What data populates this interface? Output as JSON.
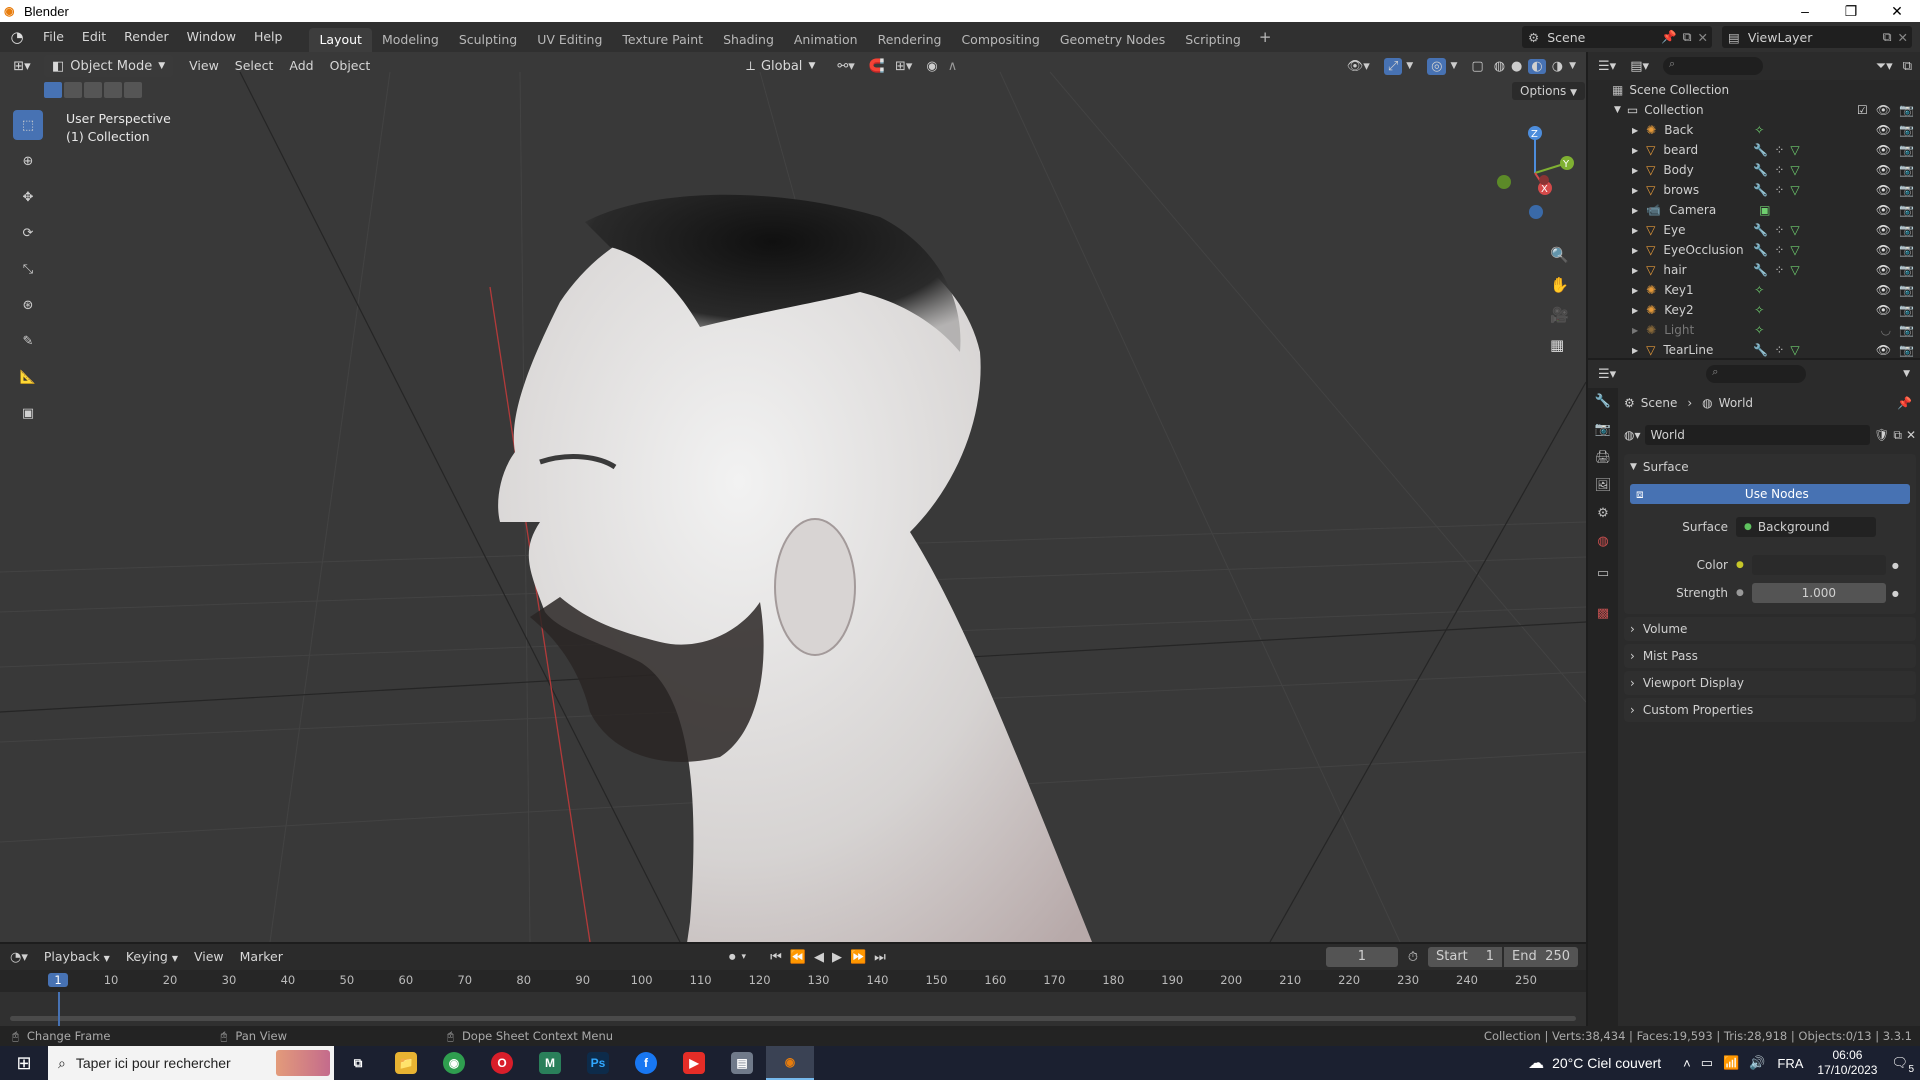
{
  "window": {
    "title": "Blender",
    "min": "–",
    "max": "❐",
    "close": "✕"
  },
  "menu": [
    "File",
    "Edit",
    "Render",
    "Window",
    "Help"
  ],
  "workspaces": [
    "Layout",
    "Modeling",
    "Sculpting",
    "UV Editing",
    "Texture Paint",
    "Shading",
    "Animation",
    "Rendering",
    "Compositing",
    "Geometry Nodes",
    "Scripting"
  ],
  "workspace_add": "+",
  "scene": {
    "label": "Scene",
    "view_layer": "ViewLayer"
  },
  "viewport": {
    "mode": "Object Mode",
    "menus": [
      "View",
      "Select",
      "Add",
      "Object"
    ],
    "orientation": "Global",
    "options": "Options",
    "overlay_title": "User Perspective",
    "overlay_sub": "(1) Collection",
    "gizmo": {
      "z": "Z",
      "y": "Y",
      "x": "X"
    }
  },
  "outliner": {
    "scene_collection": "Scene Collection",
    "collection": "Collection",
    "items": [
      {
        "name": "Back",
        "type": "light",
        "dim": false
      },
      {
        "name": "beard",
        "type": "mesh",
        "dim": false
      },
      {
        "name": "Body",
        "type": "mesh",
        "dim": false
      },
      {
        "name": "brows",
        "type": "mesh",
        "dim": false
      },
      {
        "name": "Camera",
        "type": "camera",
        "dim": false
      },
      {
        "name": "Eye",
        "type": "mesh",
        "dim": false
      },
      {
        "name": "EyeOcclusion",
        "type": "mesh",
        "dim": false
      },
      {
        "name": "hair",
        "type": "mesh",
        "dim": false
      },
      {
        "name": "Key1",
        "type": "light",
        "dim": false
      },
      {
        "name": "Key2",
        "type": "light",
        "dim": false
      },
      {
        "name": "Light",
        "type": "light",
        "dim": true
      },
      {
        "name": "TearLine",
        "type": "mesh",
        "dim": false
      }
    ]
  },
  "properties": {
    "breadcrumb_scene": "Scene",
    "breadcrumb_world": "World",
    "world_name": "World",
    "surface_header": "Surface",
    "use_nodes": "Use Nodes",
    "surface_label": "Surface",
    "surface_value": "Background",
    "color_label": "Color",
    "strength_label": "Strength",
    "strength_value": "1.000",
    "collapsed": [
      "Volume",
      "Mist Pass",
      "Viewport Display",
      "Custom Properties"
    ]
  },
  "timeline": {
    "menus": [
      "Playback",
      "Keying",
      "View",
      "Marker"
    ],
    "current_frame": "1",
    "start_label": "Start",
    "start_value": "1",
    "end_label": "End",
    "end_value": "250",
    "ticks": [
      "1",
      "10",
      "20",
      "30",
      "40",
      "50",
      "60",
      "70",
      "80",
      "90",
      "100",
      "110",
      "120",
      "130",
      "140",
      "150",
      "160",
      "170",
      "180",
      "190",
      "200",
      "210",
      "220",
      "230",
      "240",
      "250"
    ]
  },
  "status": {
    "change_frame": "Change Frame",
    "pan_view": "Pan View",
    "context_menu": "Dope Sheet Context Menu",
    "stats": "Collection | Verts:38,434 | Faces:19,593 | Tris:28,918 | Objects:0/13 | 3.3.1"
  },
  "taskbar": {
    "search": "Taper ici pour rechercher",
    "weather": "20°C  Ciel couvert",
    "lang": "FRA",
    "time": "06:06",
    "date": "17/10/2023",
    "notif": "5"
  },
  "colors": {
    "accent": "#4772b3",
    "bg": "#393939",
    "panel": "#2b2b2b"
  }
}
